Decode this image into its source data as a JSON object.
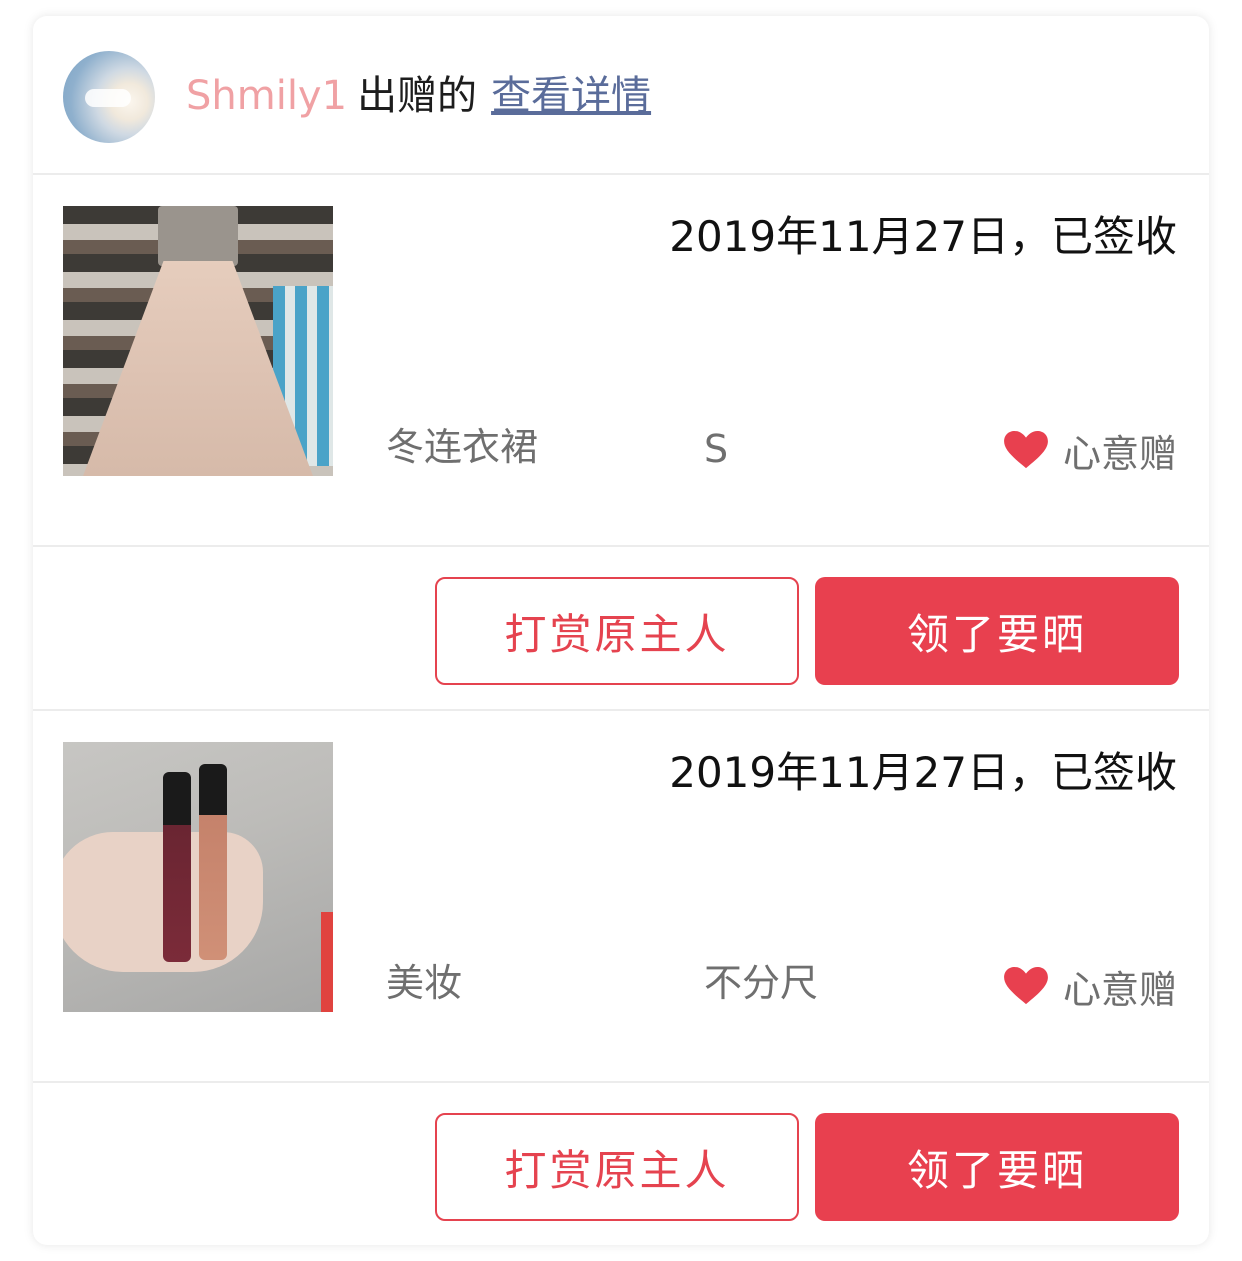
{
  "header": {
    "username": "Shmily1",
    "gave_text": "出赠的",
    "details_link": "查看详情"
  },
  "items": [
    {
      "date_status": "2019年11月27日，已签收",
      "category": "冬连衣裙",
      "size": "S",
      "gift_type": "心意赠",
      "reward_button": "打赏原主人",
      "show_button": "领了要晒"
    },
    {
      "date_status": "2019年11月27日，已签收",
      "category": "美妆",
      "size": "不分尺",
      "gift_type": "心意赠",
      "reward_button": "打赏原主人",
      "show_button": "领了要晒"
    }
  ],
  "colors": {
    "accent": "#e8404f",
    "username": "#f0a1a4",
    "link": "#5a6c9a",
    "muted_text": "#6f6f6f"
  },
  "icons": {
    "heart": "heart-icon"
  }
}
